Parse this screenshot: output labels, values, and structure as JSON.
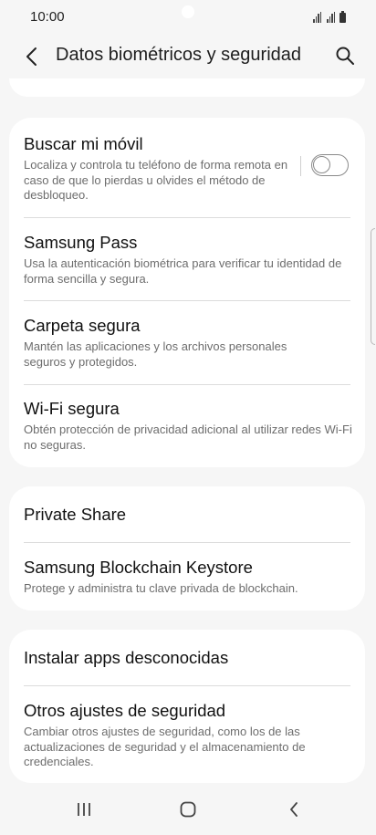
{
  "status": {
    "time": "10:00"
  },
  "header": {
    "title": "Datos biométricos y seguridad",
    "back_icon": "chevron-left-icon",
    "search_icon": "search-icon"
  },
  "card1": {
    "items": [
      {
        "title": "Buscar mi móvil",
        "subtitle": "Localiza y controla tu teléfono de forma remota en caso de que lo pierdas u olvides el método de desbloqueo.",
        "toggle": false
      },
      {
        "title": "Samsung Pass",
        "subtitle": "Usa la autenticación biométrica para verificar tu identidad de forma sencilla y segura."
      },
      {
        "title": "Carpeta segura",
        "subtitle": "Mantén las aplicaciones y los archivos personales seguros y protegidos."
      },
      {
        "title": "Wi-Fi segura",
        "subtitle": "Obtén protección de privacidad adicional al utilizar redes Wi-Fi no seguras."
      }
    ]
  },
  "card2": {
    "items": [
      {
        "title": "Private Share"
      },
      {
        "title": "Samsung Blockchain Keystore",
        "subtitle": "Protege y administra tu clave privada de blockchain."
      }
    ]
  },
  "card3": {
    "items": [
      {
        "title": "Instalar apps desconocidas"
      },
      {
        "title": "Otros ajustes de seguridad",
        "subtitle": "Cambiar otros ajustes de seguridad, como los de las actualizaciones de seguridad y el almacenamiento de credenciales."
      }
    ]
  },
  "navbar": {
    "recents_icon": "recents-icon",
    "home_icon": "home-icon",
    "back_icon": "back-icon"
  },
  "colors": {
    "background": "#f6f6f6",
    "card": "#ffffff",
    "subtitle": "#6d6d6d"
  }
}
